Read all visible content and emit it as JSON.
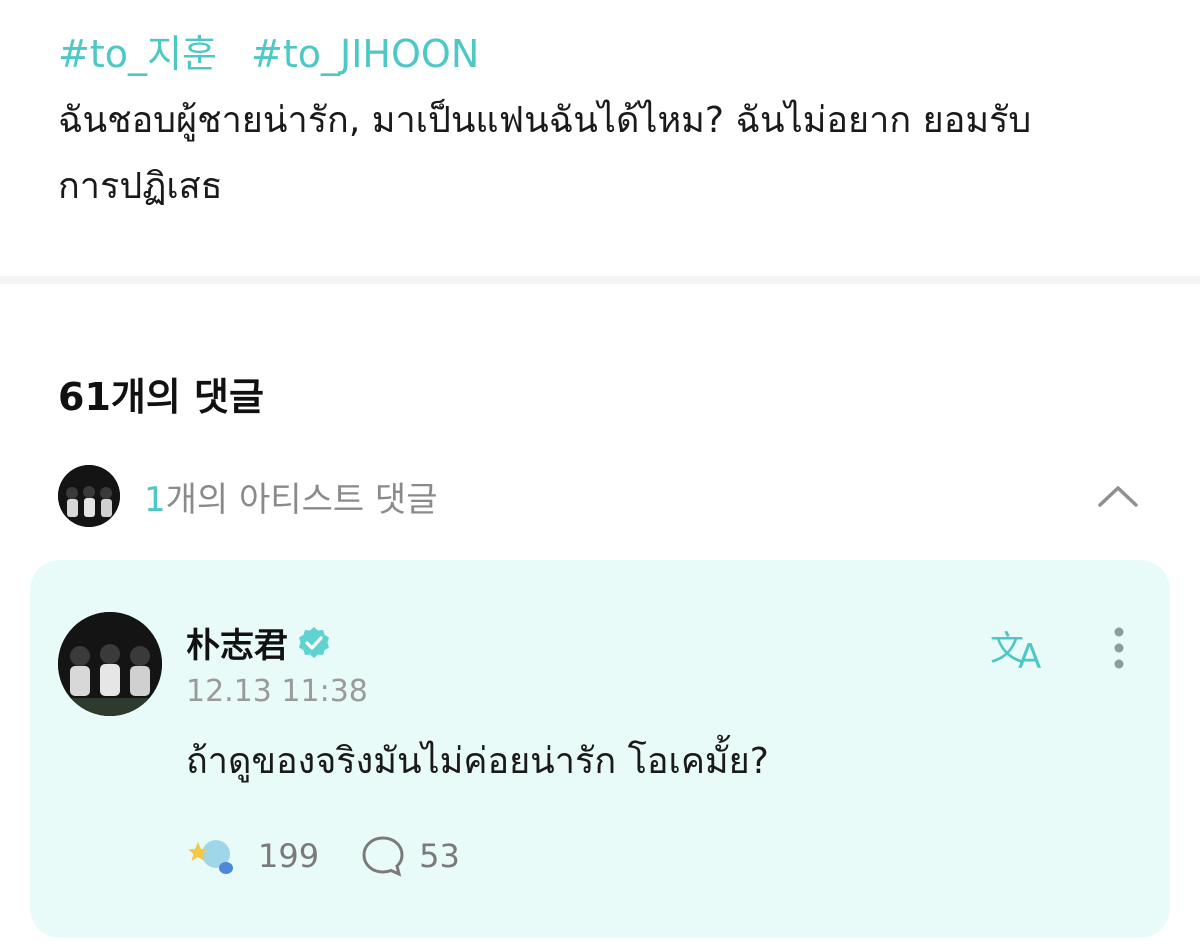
{
  "post": {
    "hashtags": [
      "#to_지훈",
      "#to_JIHOON"
    ],
    "body": "ฉันชอบผู้ชายน่ารัก, มาเป็นแฟนฉันได้ไหม? ฉันไม่อยาก ยอมรับการปฏิเสธ"
  },
  "comments": {
    "count_label": "61개의 댓글",
    "artist_section": {
      "count": "1",
      "label_suffix": "개의 아티스트 댓글",
      "icon": "chevron-up-icon"
    },
    "artist_comment": {
      "author": "朴志君",
      "verified": true,
      "timestamp": "12.13 11:38",
      "text": "ถ้าดูของจริงมันไม่ค่อยน่ารัก โอเคมั้ย?",
      "likes": "199",
      "replies": "53",
      "icons": {
        "translate": "translate-icon",
        "more": "more-vertical-icon",
        "like": "star-reaction-icon",
        "reply": "speech-bubble-icon"
      }
    }
  },
  "colors": {
    "accent": "#4ec8c4",
    "card_bg": "#e9fbf8",
    "muted": "#9a9a9a"
  }
}
